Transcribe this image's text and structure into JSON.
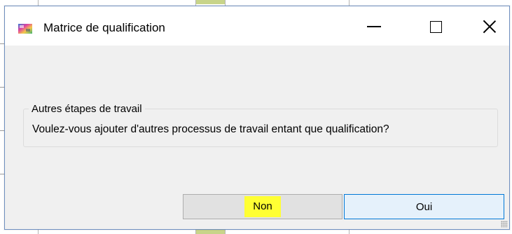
{
  "window": {
    "title": "Matrice de qualification",
    "icon": "app-color-icon"
  },
  "titlebar_controls": {
    "minimize_icon": "minimize-icon",
    "maximize_icon": "maximize-icon",
    "close_icon": "close-icon"
  },
  "group": {
    "legend": "Autres étapes de travail",
    "message": "Voulez-vous ajouter d'autres processus de travail entant que qualification?"
  },
  "buttons": {
    "no_label": "Non",
    "yes_label": "Oui"
  },
  "colors": {
    "highlight": "#ffff33",
    "default_button_border": "#0078d7"
  }
}
